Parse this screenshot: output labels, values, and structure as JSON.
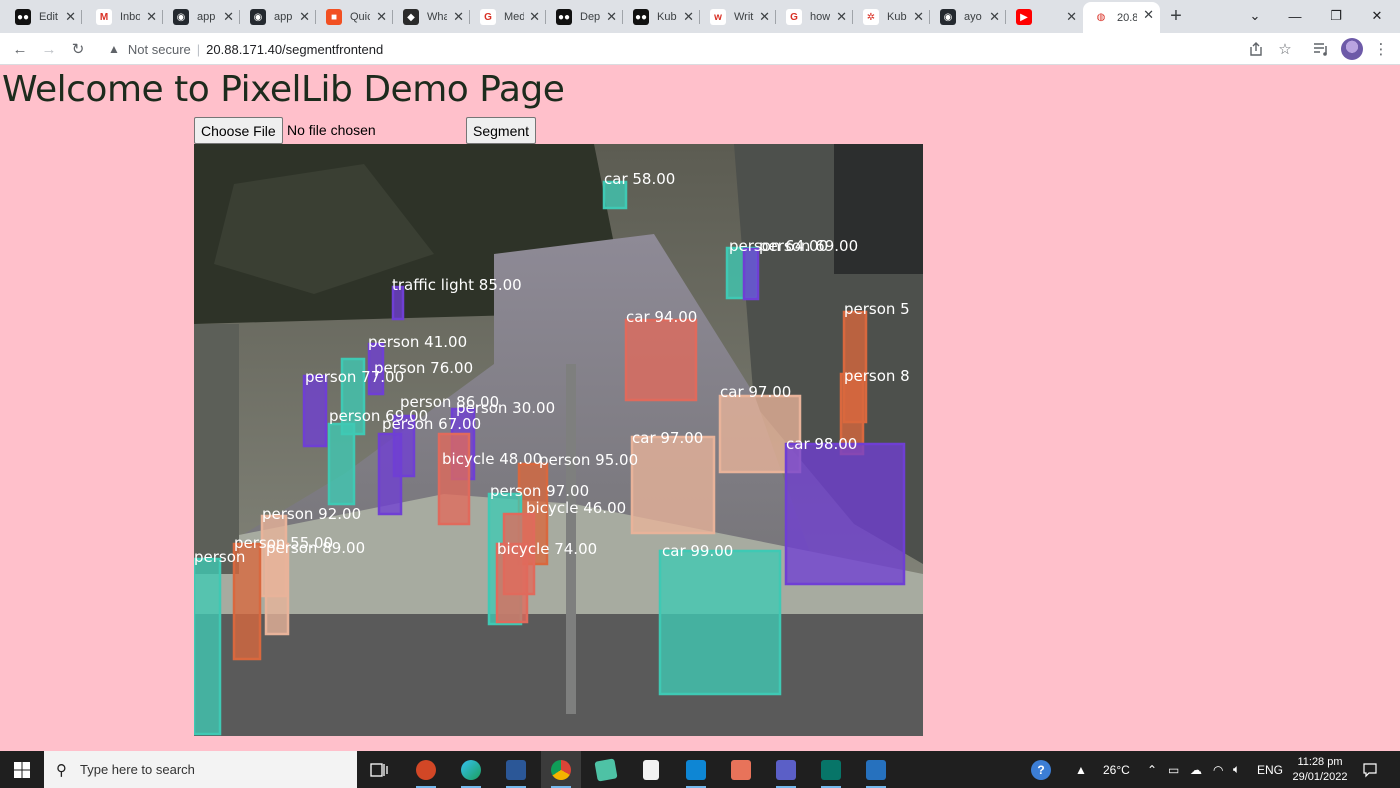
{
  "browser": {
    "tabs": [
      {
        "title": "Edit",
        "favicon": "medium-icon",
        "color": "#111111",
        "glyph": "●●"
      },
      {
        "title": "Inbox",
        "favicon": "gmail-icon",
        "color": "#ffffff",
        "glyph": "M"
      },
      {
        "title": "app",
        "favicon": "github-icon",
        "color": "#24292f",
        "glyph": "◉"
      },
      {
        "title": "app",
        "favicon": "github-icon",
        "color": "#24292f",
        "glyph": "◉"
      },
      {
        "title": "Quick",
        "favicon": "microsoft-icon",
        "color": "#f25022",
        "glyph": "■"
      },
      {
        "title": "What",
        "favicon": "bookmark-icon",
        "color": "#2b2b2b",
        "glyph": "◆"
      },
      {
        "title": "Med",
        "favicon": "google-icon",
        "color": "#ffffff",
        "glyph": "G"
      },
      {
        "title": "Dep",
        "favicon": "medium-icon",
        "color": "#111111",
        "glyph": "●●"
      },
      {
        "title": "Kub",
        "favicon": "medium-icon",
        "color": "#111111",
        "glyph": "●●"
      },
      {
        "title": "Writ",
        "favicon": "wordtune-icon",
        "color": "#ffffff",
        "glyph": "w"
      },
      {
        "title": "how",
        "favicon": "google-icon",
        "color": "#ffffff",
        "glyph": "G"
      },
      {
        "title": "Kub",
        "favicon": "kubernetes-icon",
        "color": "#ffffff",
        "glyph": "✲"
      },
      {
        "title": "ayo",
        "favicon": "github-icon",
        "color": "#24292f",
        "glyph": "◉"
      },
      {
        "title": "",
        "favicon": "youtube-icon",
        "color": "#ff0000",
        "glyph": "▶"
      },
      {
        "title": "20.8",
        "favicon": "globe-icon",
        "color": "#ffffff",
        "glyph": "◍"
      }
    ],
    "new_tab": "+",
    "window_controls": {
      "tabsearch": "⌄",
      "minimize": "—",
      "maximize": "❐",
      "close": "✕"
    },
    "toolbar": {
      "back": "←",
      "forward": "→",
      "reload": "↻"
    },
    "address": {
      "security_label": "Not secure",
      "url": "20.88.171.40/segmentfrontend"
    }
  },
  "page": {
    "heading": "Welcome to PixelLib Demo Page",
    "file_button": "Choose File",
    "file_status": "No file chosen",
    "segment_button": "Segment",
    "detections": [
      {
        "label": "car 58.00"
      },
      {
        "label": "person 64.00"
      },
      {
        "label": "person 69.00"
      },
      {
        "label": "traffic light 85.00"
      },
      {
        "label": "car 94.00"
      },
      {
        "label": "person 5"
      },
      {
        "label": "person 41.00"
      },
      {
        "label": "person 77.00"
      },
      {
        "label": "person 76.00"
      },
      {
        "label": "person 86.00"
      },
      {
        "label": "person 30.00"
      },
      {
        "label": "car 97.00"
      },
      {
        "label": "person 8"
      },
      {
        "label": "person 69.00"
      },
      {
        "label": "person 67.00"
      },
      {
        "label": "car 97.00"
      },
      {
        "label": "car 98.00"
      },
      {
        "label": "bicycle 48.00"
      },
      {
        "label": "person 95.00"
      },
      {
        "label": "person 97.00"
      },
      {
        "label": "bicycle 46.00"
      },
      {
        "label": "person 92.00"
      },
      {
        "label": "person 55.00"
      },
      {
        "label": "person 89.00"
      },
      {
        "label": "bicycle 74.00"
      },
      {
        "label": "car 99.00"
      },
      {
        "label": "person"
      }
    ]
  },
  "taskbar": {
    "search_placeholder": "Type here to search",
    "weather": "26°C",
    "language": "ENG",
    "time": "11:28 pm",
    "date": "29/01/2022"
  }
}
